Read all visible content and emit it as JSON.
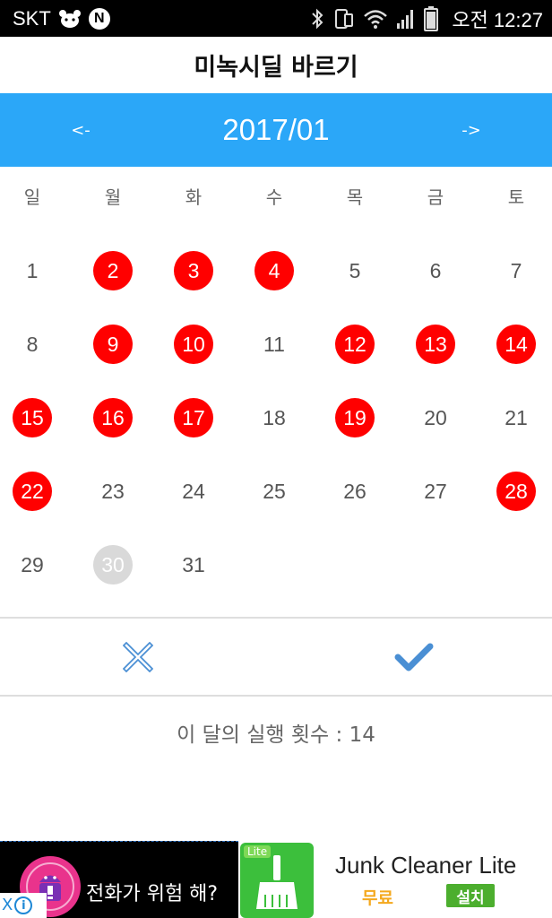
{
  "status_bar": {
    "carrier": "SKT",
    "network_badge": "N",
    "time": "오전 12:27",
    "icons": [
      "bear-icon",
      "bluetooth-icon",
      "vibrate-icon",
      "wifi-icon",
      "signal-icon",
      "battery-icon"
    ]
  },
  "app": {
    "title": "미녹시딜 바르기"
  },
  "calendar": {
    "prev_label": "<-",
    "next_label": "->",
    "month": "2017/01",
    "weekdays": [
      "일",
      "월",
      "화",
      "수",
      "목",
      "금",
      "토"
    ],
    "days": [
      {
        "day": "1",
        "state": "normal"
      },
      {
        "day": "2",
        "state": "marked"
      },
      {
        "day": "3",
        "state": "marked"
      },
      {
        "day": "4",
        "state": "marked"
      },
      {
        "day": "5",
        "state": "normal"
      },
      {
        "day": "6",
        "state": "normal"
      },
      {
        "day": "7",
        "state": "normal"
      },
      {
        "day": "8",
        "state": "normal"
      },
      {
        "day": "9",
        "state": "marked"
      },
      {
        "day": "10",
        "state": "marked"
      },
      {
        "day": "11",
        "state": "normal"
      },
      {
        "day": "12",
        "state": "marked"
      },
      {
        "day": "13",
        "state": "marked"
      },
      {
        "day": "14",
        "state": "marked"
      },
      {
        "day": "15",
        "state": "marked"
      },
      {
        "day": "16",
        "state": "marked"
      },
      {
        "day": "17",
        "state": "marked"
      },
      {
        "day": "18",
        "state": "normal"
      },
      {
        "day": "19",
        "state": "marked"
      },
      {
        "day": "20",
        "state": "normal"
      },
      {
        "day": "21",
        "state": "normal"
      },
      {
        "day": "22",
        "state": "marked"
      },
      {
        "day": "23",
        "state": "normal"
      },
      {
        "day": "24",
        "state": "normal"
      },
      {
        "day": "25",
        "state": "normal"
      },
      {
        "day": "26",
        "state": "normal"
      },
      {
        "day": "27",
        "state": "normal"
      },
      {
        "day": "28",
        "state": "marked"
      },
      {
        "day": "29",
        "state": "normal"
      },
      {
        "day": "30",
        "state": "today"
      },
      {
        "day": "31",
        "state": "normal"
      }
    ]
  },
  "actions": {
    "cancel_icon": "close-icon",
    "confirm_icon": "check-icon"
  },
  "summary": {
    "count_text": "이 달의 실행 횟수 : 14"
  },
  "ad": {
    "headline": "전화가 위험 해?",
    "lite_badge": "Lite",
    "app_name": "Junk Cleaner Lite",
    "price": "무료",
    "install_label": "설치",
    "info_symbol": "i",
    "close_symbol": "X"
  },
  "colors": {
    "accent": "#2ba7f8",
    "marked": "#ff0000",
    "today": "#d9d9d9",
    "check": "#4a8fd4"
  }
}
